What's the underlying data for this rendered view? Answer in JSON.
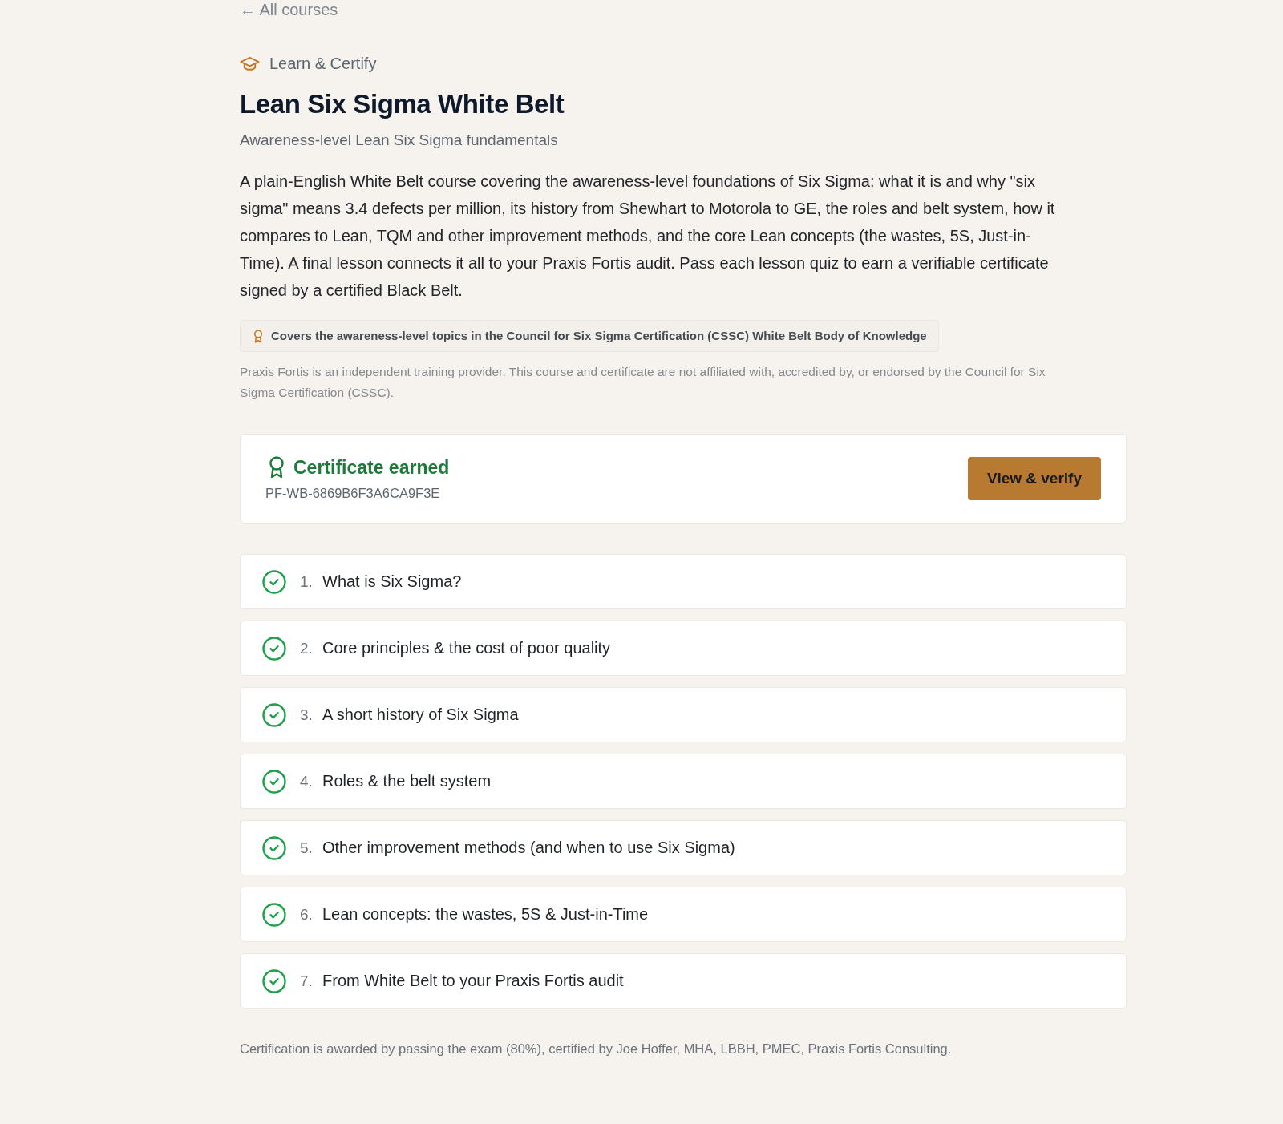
{
  "back_link": "← All courses",
  "eyebrow": "Learn & Certify",
  "title": "Lean Six Sigma White Belt",
  "subtitle": "Awareness-level Lean Six Sigma fundamentals",
  "description": "A plain-English White Belt course covering the awareness-level foundations of Six Sigma: what it is and why \"six sigma\" means 3.4 defects per million, its history from Shewhart to Motorola to GE, the roles and belt system, how it compares to Lean, TQM and other improvement methods, and the core Lean concepts (the wastes, 5S, Just-in-Time). A final lesson connects it all to your Praxis Fortis audit. Pass each lesson quiz to earn a verifiable certificate signed by a certified Black Belt.",
  "coverage_note": "Covers the awareness-level topics in the Council for Six Sigma Certification (CSSC) White Belt Body of Knowledge",
  "disclaimer": "Praxis Fortis is an independent training provider. This course and certificate are not affiliated with, accredited by, or endorsed by the Council for Six Sigma Certification (CSSC).",
  "certificate": {
    "status": "Certificate earned",
    "code": "PF-WB-6869B6F3A6CA9F3E",
    "button": "View & verify"
  },
  "lessons": [
    {
      "number": "1.",
      "title": "What is Six Sigma?",
      "completed": true
    },
    {
      "number": "2.",
      "title": "Core principles & the cost of poor quality",
      "completed": true
    },
    {
      "number": "3.",
      "title": "A short history of Six Sigma",
      "completed": true
    },
    {
      "number": "4.",
      "title": "Roles & the belt system",
      "completed": true
    },
    {
      "number": "5.",
      "title": "Other improvement methods (and when to use Six Sigma)",
      "completed": true
    },
    {
      "number": "6.",
      "title": "Lean concepts: the wastes, 5S & Just-in-Time",
      "completed": true
    },
    {
      "number": "7.",
      "title": "From White Belt to your Praxis Fortis audit",
      "completed": true
    }
  ],
  "footer_note": "Certification is awarded by passing the exam (80%), certified by Joe Hoffer, MHA, LBBH, PMEC, Praxis Fortis Consulting."
}
